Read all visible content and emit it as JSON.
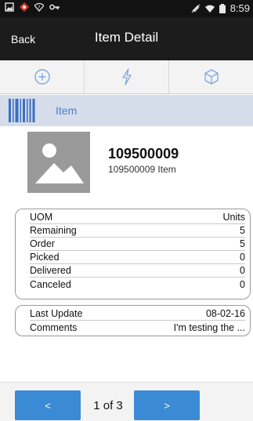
{
  "status_bar": {
    "time": "8:59"
  },
  "header": {
    "back_label": "Back",
    "title": "Item Detail"
  },
  "toolbar": {
    "buttons": [
      {
        "icon": "add-circle-icon"
      },
      {
        "icon": "lightning-icon"
      },
      {
        "icon": "cube-icon"
      }
    ]
  },
  "item_header": {
    "label": "Item"
  },
  "item": {
    "id": "109500009",
    "description": "109500009 Item"
  },
  "details": [
    {
      "label": "UOM",
      "value": "Units"
    },
    {
      "label": "Remaining",
      "value": "5"
    },
    {
      "label": "Order",
      "value": "5"
    },
    {
      "label": "Picked",
      "value": "0"
    },
    {
      "label": "Delivered",
      "value": "0"
    },
    {
      "label": "Canceled",
      "value": "0"
    }
  ],
  "extra_details": [
    {
      "label": "Last Update",
      "value": "08-02-16"
    },
    {
      "label": "Comments",
      "value": "I'm testing the ..."
    }
  ],
  "pager": {
    "prev_label": "<",
    "next_label": ">",
    "text": "1 of 3"
  },
  "colors": {
    "accent": "#3b8ad5",
    "item_header_bg": "#d4dde9",
    "item_header_text": "#4a7fd0",
    "app_bar_bg": "#1c1c1c"
  }
}
